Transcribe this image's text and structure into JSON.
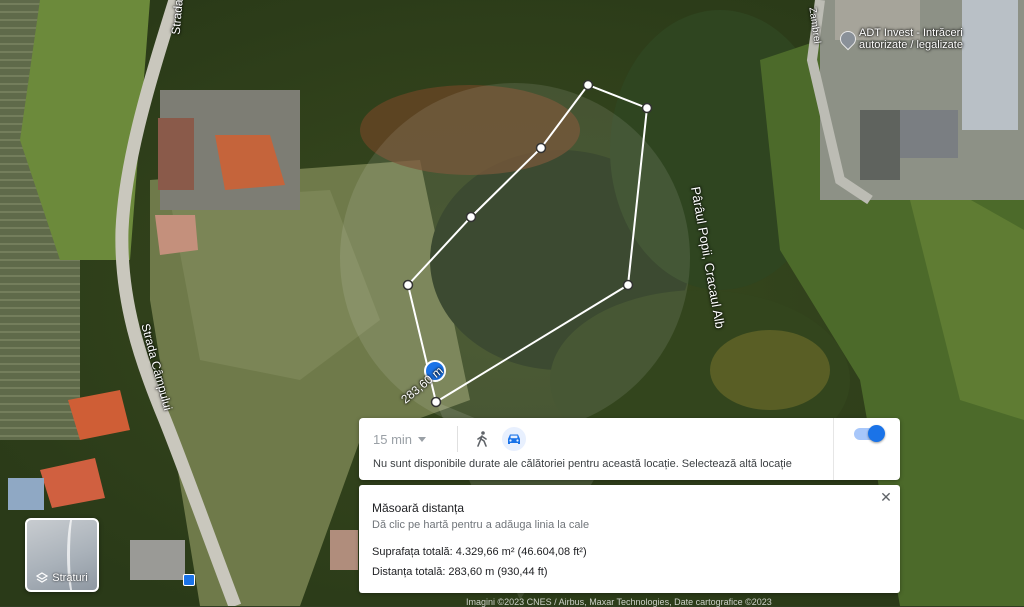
{
  "map": {
    "labels": {
      "street_top": "Strada C",
      "street_campului": "Strada Câmpului",
      "stream": "Pârâul Popii, Cracaul Alb",
      "street_right": "Zambrel"
    },
    "place_pin": {
      "line1": "ADT Invest - Intrăceri",
      "line2": "autorizate / legalizate"
    },
    "measure_label": "283,60 m",
    "polygon_vertices_latlng_note": ""
  },
  "travel_card": {
    "time_value": "15 min",
    "modes": [
      {
        "name": "walking",
        "icon": "walking-icon",
        "active": false
      },
      {
        "name": "driving",
        "icon": "car-icon",
        "active": true
      }
    ],
    "message": "Nu sunt disponibile durate ale călătoriei pentru această locație. Selectează altă locație",
    "toggle_on": true
  },
  "measure_panel": {
    "title": "Măsoară distanța",
    "hint": "Dă clic pe hartă pentru a adăuga linia la cale",
    "area": "Suprafața totală: 4.329,66 m² (46.604,08 ft²)",
    "distance": "Distanța totală: 283,60 m (930,44 ft)",
    "close_icon": "close-icon"
  },
  "layers_button": {
    "label": "Straturi",
    "icon": "layers-icon"
  },
  "attribution": "Imagini ©2023 CNES / Airbus, Maxar Technologies, Date cartografice ©2023",
  "colors": {
    "accent": "#1a73e8",
    "measure_line": "#ffffff",
    "toggle_track": "#a8c7fa"
  }
}
